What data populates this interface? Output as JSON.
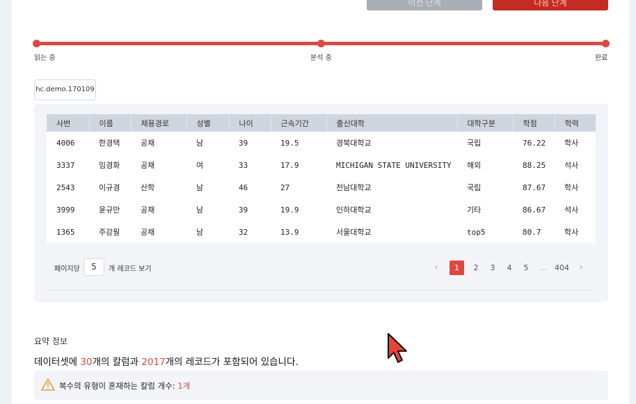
{
  "toolbar": {
    "back_label": "이전 단계",
    "next_label": "다음 단계"
  },
  "progress": {
    "steps": [
      "읽는 중",
      "분석 중",
      "완료"
    ],
    "fraction": 1.0
  },
  "dataset_tag": "hc.demo.170109",
  "table": {
    "columns": [
      "사번",
      "이름",
      "채용경로",
      "성별",
      "나이",
      "근속기간",
      "출신대학",
      "대학구분",
      "학점",
      "학력"
    ],
    "rows": [
      [
        "4006",
        "한경택",
        "공채",
        "남",
        "39",
        "19.5",
        "경북대학교",
        "국립",
        "76.22",
        "학사"
      ],
      [
        "3337",
        "임경화",
        "공채",
        "여",
        "33",
        "17.9",
        "MICHIGAN STATE UNIVERSITY",
        "해외",
        "88.25",
        "석사"
      ],
      [
        "2543",
        "이규경",
        "산학",
        "남",
        "46",
        "27",
        "전남대학교",
        "국립",
        "87.67",
        "학사"
      ],
      [
        "3999",
        "윤규만",
        "공채",
        "남",
        "39",
        "19.9",
        "인하대학교",
        "기타",
        "86.67",
        "석사"
      ],
      [
        "1365",
        "주강필",
        "공채",
        "남",
        "32",
        "13.9",
        "서울대학교",
        "top5",
        "80.7",
        "학사"
      ]
    ]
  },
  "pagination": {
    "per_page_label": "페이지당",
    "per_page_value": "5",
    "per_page_suffix": "개 레코드 보기",
    "prev": "‹",
    "next": "›",
    "pages": [
      "1",
      "2",
      "3",
      "4",
      "5",
      "...",
      "404"
    ],
    "active": "1"
  },
  "summary": {
    "title": "요약 정보",
    "text_prefix": "데이터셋에 ",
    "columns_count": "30",
    "text_mid": "개의 칼럼과 ",
    "records_count": "2017",
    "text_suffix": "개의 레코드가 포함되어 있습니다."
  },
  "warning": {
    "icon": "warning-triangle-icon",
    "label": "복수의 유형이 혼재하는 칼럼 개수: ",
    "value": "1개"
  },
  "colors": {
    "accent": "#d94a42",
    "button_gray": "#a9adb4",
    "button_red": "#c42b22"
  }
}
